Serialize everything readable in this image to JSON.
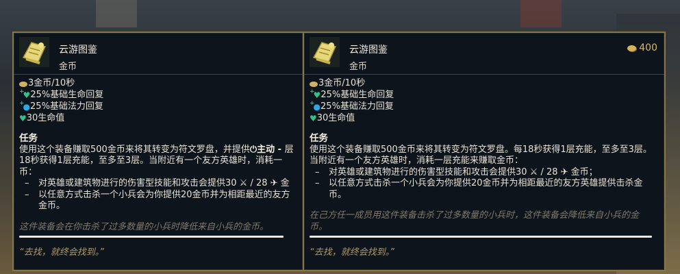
{
  "left_card": {
    "title": "云游图鉴",
    "subtitle": "金币",
    "stats": [
      {
        "icon": "gold-coin-icon",
        "text": "3金币/10秒"
      },
      {
        "icon": "health-regen-icon",
        "text": "25%基础生命回复"
      },
      {
        "icon": "mana-regen-icon",
        "text": "25%基础法力回复"
      },
      {
        "icon": "health-icon",
        "text": "30生命值"
      }
    ],
    "quest_title": "任务",
    "desc_line1": "使用这个装备赚取500金币来将其转变为符文罗盘，并提供",
    "desc_line1_b": "主动 - ",
    "desc_line1_c": "层",
    "desc_line2": "18秒获得1层充能，至多至3层。当附近有一个友方英雄时，消耗一",
    "desc_line3": "币：",
    "bullet1": "对英雄或建筑物进行的伤害型技能和攻击会提供30 ⚔ / 28 ✈ 金",
    "bullet2": "以任意方式击杀一个小兵会为你提供20金币并为相距最近的友方",
    "bullet2_b": "金币。",
    "flavor": "这件装备会在你击杀了过多数量的小兵时降低来自小兵的金币。",
    "quote": "“去找，就终会找到。”"
  },
  "right_card": {
    "title": "云游图鉴",
    "subtitle": "金币",
    "price": "400",
    "stats": [
      {
        "icon": "gold-coin-icon",
        "text": "3金币/10秒"
      },
      {
        "icon": "health-regen-icon",
        "text": "25%基础生命回复"
      },
      {
        "icon": "mana-regen-icon",
        "text": "25%基础法力回复"
      },
      {
        "icon": "health-icon",
        "text": "30生命值"
      }
    ],
    "quest_title": "任务",
    "desc": "使用这个装备赚取500金币来将其转变为符文罗盘。每18秒获得1层充能，至多至3层。当附近有一个友方英雄时，消耗一层充能来赚取金币：",
    "bullet1": "对英雄或建筑物进行的伤害型技能和攻击会提供30 ⚔ / 28 ✈ 金币；",
    "bullet2": "以任意方式击杀一个小兵会为你提供20金币并为相距最近的友方英雄提供击杀金币。",
    "flavor": "在己方任一成员用这件装备击杀了过多数量的小兵时，这件装备会降低来自小兵的金币。",
    "quote": "“去找，就终会找到。”"
  },
  "colors": {
    "border": "#8a7544",
    "panel": "#0d141b",
    "gold": "#d9b867",
    "heal": "#35c08a",
    "mana": "#2fa8e8"
  }
}
